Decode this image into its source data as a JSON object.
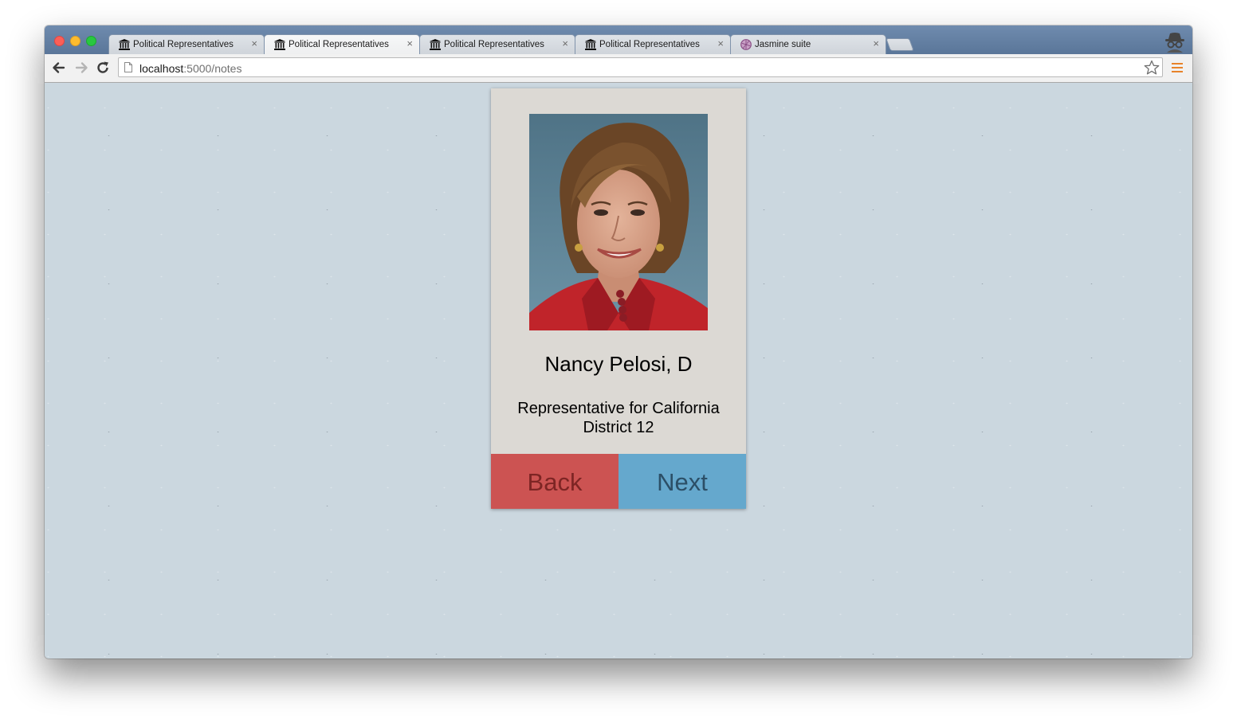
{
  "browser": {
    "tabs": [
      {
        "title": "Political Representatives",
        "icon": "institution-icon",
        "active": false
      },
      {
        "title": "Political Representatives",
        "icon": "institution-icon",
        "active": true
      },
      {
        "title": "Political Representatives",
        "icon": "institution-icon",
        "active": false
      },
      {
        "title": "Political Representatives",
        "icon": "institution-icon",
        "active": false
      },
      {
        "title": "Jasmine suite",
        "icon": "jasmine-icon",
        "active": false
      }
    ],
    "tab_close_glyph": "×",
    "url_host": "localhost",
    "url_rest": ":5000/notes",
    "accent_menu_color": "#e8832a"
  },
  "card": {
    "name": "Nancy Pelosi, D",
    "title": "Representative for California District 12",
    "back_label": "Back",
    "next_label": "Next",
    "colors": {
      "card_bg": "#dcd9d4",
      "back_bg": "#cc5352",
      "back_text": "#7d2524",
      "next_bg": "#65a8cd",
      "next_text": "#2c4f67"
    }
  }
}
